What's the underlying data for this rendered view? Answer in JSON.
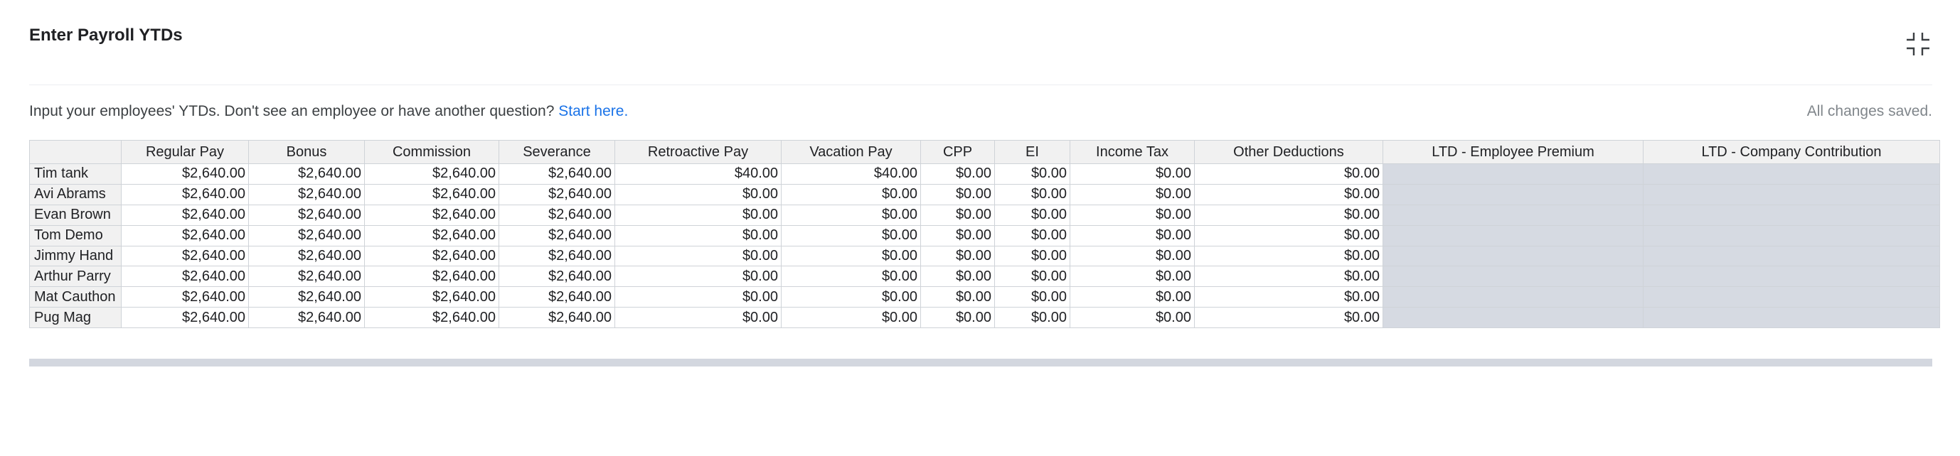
{
  "header": {
    "title": "Enter Payroll YTDs",
    "collapse_icon": "collapse-icon"
  },
  "subbar": {
    "intro": "Input your employees' YTDs. Don't see an employee or have another question?",
    "link": "Start here.",
    "status": "All changes saved."
  },
  "grid": {
    "columns": [
      "",
      "Regular Pay",
      "Bonus",
      "Commission",
      "Severance",
      "Retroactive Pay",
      "Vacation Pay",
      "CPP",
      "EI",
      "Income Tax",
      "Other Deductions",
      "LTD - Employee Premium",
      "LTD - Company Contribution"
    ],
    "rows": [
      {
        "name": "Tim tank",
        "values": [
          "$2,640.00",
          "$2,640.00",
          "$2,640.00",
          "$2,640.00",
          "$40.00",
          "$40.00",
          "$0.00",
          "$0.00",
          "$0.00",
          "$0.00",
          "",
          ""
        ]
      },
      {
        "name": "Avi Abrams",
        "values": [
          "$2,640.00",
          "$2,640.00",
          "$2,640.00",
          "$2,640.00",
          "$0.00",
          "$0.00",
          "$0.00",
          "$0.00",
          "$0.00",
          "$0.00",
          "",
          ""
        ]
      },
      {
        "name": "Evan Brown",
        "values": [
          "$2,640.00",
          "$2,640.00",
          "$2,640.00",
          "$2,640.00",
          "$0.00",
          "$0.00",
          "$0.00",
          "$0.00",
          "$0.00",
          "$0.00",
          "",
          ""
        ]
      },
      {
        "name": "Tom Demo",
        "values": [
          "$2,640.00",
          "$2,640.00",
          "$2,640.00",
          "$2,640.00",
          "$0.00",
          "$0.00",
          "$0.00",
          "$0.00",
          "$0.00",
          "$0.00",
          "",
          ""
        ]
      },
      {
        "name": "Jimmy Hand",
        "values": [
          "$2,640.00",
          "$2,640.00",
          "$2,640.00",
          "$2,640.00",
          "$0.00",
          "$0.00",
          "$0.00",
          "$0.00",
          "$0.00",
          "$0.00",
          "",
          ""
        ]
      },
      {
        "name": "Arthur Parry",
        "values": [
          "$2,640.00",
          "$2,640.00",
          "$2,640.00",
          "$2,640.00",
          "$0.00",
          "$0.00",
          "$0.00",
          "$0.00",
          "$0.00",
          "$0.00",
          "",
          ""
        ]
      },
      {
        "name": "Mat Cauthon",
        "values": [
          "$2,640.00",
          "$2,640.00",
          "$2,640.00",
          "$2,640.00",
          "$0.00",
          "$0.00",
          "$0.00",
          "$0.00",
          "$0.00",
          "$0.00",
          "",
          ""
        ]
      },
      {
        "name": "Pug Mag",
        "values": [
          "$2,640.00",
          "$2,640.00",
          "$2,640.00",
          "$2,640.00",
          "$0.00",
          "$0.00",
          "$0.00",
          "$0.00",
          "$0.00",
          "$0.00",
          "",
          ""
        ]
      }
    ]
  }
}
